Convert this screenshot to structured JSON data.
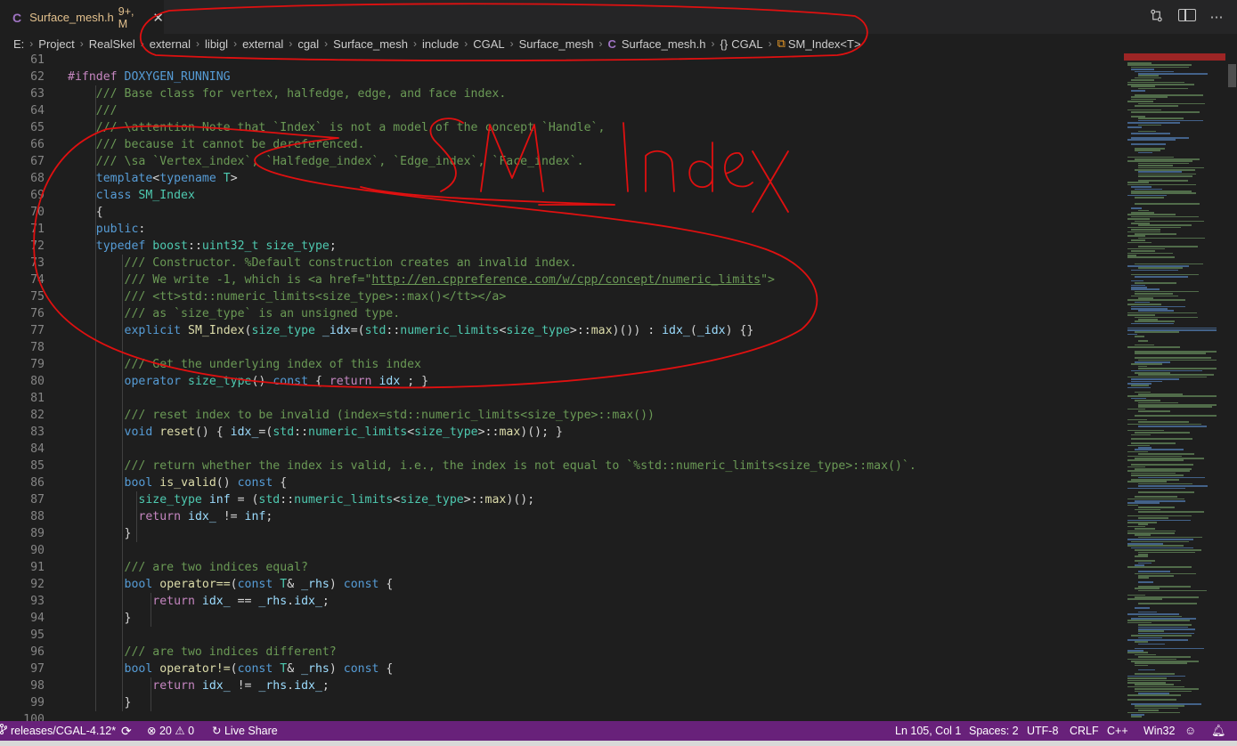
{
  "tab": {
    "icon_letter": "C",
    "filename": "Surface_mesh.h",
    "status": "9+, M",
    "close": "✕",
    "actions": {
      "compare_icon": "compare-changes-icon",
      "split_icon": "split-editor-icon",
      "more": "⋯"
    }
  },
  "breadcrumb": {
    "path": [
      "E:",
      "Project",
      "RealSkel",
      "external",
      "libigl",
      "external",
      "cgal",
      "Surface_mesh",
      "include",
      "CGAL",
      "Surface_mesh"
    ],
    "file_icon": "C",
    "file": "Surface_mesh.h",
    "namespace_icon": "{}",
    "namespace": "CGAL",
    "class_icon": "class-icon",
    "class": "SM_Index<T>"
  },
  "editor": {
    "lines": [
      {
        "n": "61",
        "t": ""
      },
      {
        "n": "62",
        "t": "#ifndef DOXYGEN_RUNNING"
      },
      {
        "n": "63",
        "t": "    /// Base class for vertex, halfedge, edge, and face index."
      },
      {
        "n": "64",
        "t": "    ///"
      },
      {
        "n": "65",
        "t": "    /// \\attention Note that `Index` is not a model of the concept `Handle`,"
      },
      {
        "n": "66",
        "t": "    /// because it cannot be dereferenced."
      },
      {
        "n": "67",
        "t": "    /// \\sa `Vertex_index`, `Halfedge_index`, `Edge_index`, `Face_index`."
      },
      {
        "n": "68",
        "t": "    template<typename T>"
      },
      {
        "n": "69",
        "t": "    class SM_Index"
      },
      {
        "n": "70",
        "t": "    {"
      },
      {
        "n": "71",
        "t": "    public:"
      },
      {
        "n": "72",
        "t": "    typedef boost::uint32_t size_type;"
      },
      {
        "n": "73",
        "t": "        /// Constructor. %Default construction creates an invalid index."
      },
      {
        "n": "74",
        "t": "        /// We write -1, which is <a href=\"http://en.cppreference.com/w/cpp/concept/numeric_limits\">"
      },
      {
        "n": "75",
        "t": "        /// <tt>std::numeric_limits<size_type>::max()</tt></a>"
      },
      {
        "n": "76",
        "t": "        /// as `size_type` is an unsigned type."
      },
      {
        "n": "77",
        "t": "        explicit SM_Index(size_type _idx=(std::numeric_limits<size_type>::max)()) : idx_(_idx) {}"
      },
      {
        "n": "78",
        "t": ""
      },
      {
        "n": "79",
        "t": "        /// Get the underlying index of this index"
      },
      {
        "n": "80",
        "t": "        operator size_type() const { return idx_; }"
      },
      {
        "n": "81",
        "t": ""
      },
      {
        "n": "82",
        "t": "        /// reset index to be invalid (index=std::numeric_limits<size_type>::max())"
      },
      {
        "n": "83",
        "t": "        void reset() { idx_=(std::numeric_limits<size_type>::max)(); }"
      },
      {
        "n": "84",
        "t": ""
      },
      {
        "n": "85",
        "t": "        /// return whether the index is valid, i.e., the index is not equal to `%std::numeric_limits<size_type>::max()`."
      },
      {
        "n": "86",
        "t": "        bool is_valid() const {"
      },
      {
        "n": "87",
        "t": "          size_type inf = (std::numeric_limits<size_type>::max)();"
      },
      {
        "n": "88",
        "t": "          return idx_ != inf;"
      },
      {
        "n": "89",
        "t": "        }"
      },
      {
        "n": "90",
        "t": ""
      },
      {
        "n": "91",
        "t": "        /// are two indices equal?"
      },
      {
        "n": "92",
        "t": "        bool operator==(const T& _rhs) const {"
      },
      {
        "n": "93",
        "t": "            return idx_ == _rhs.idx_;"
      },
      {
        "n": "94",
        "t": "        }"
      },
      {
        "n": "95",
        "t": ""
      },
      {
        "n": "96",
        "t": "        /// are two indices different?"
      },
      {
        "n": "97",
        "t": "        bool operator!=(const T& _rhs) const {"
      },
      {
        "n": "98",
        "t": "            return idx_ != _rhs.idx_;"
      },
      {
        "n": "99",
        "t": "        }"
      },
      {
        "n": "100",
        "t": ""
      }
    ]
  },
  "annotation": {
    "handwritten_text": "SM_Index",
    "color": "#e01010"
  },
  "statusbar": {
    "branch": "releases/CGAL-4.12*",
    "errors": "20",
    "warnings": "0",
    "live_share": "Live Share",
    "position": "Ln 105, Col 1",
    "spaces": "Spaces: 2",
    "encoding": "UTF-8",
    "eol": "CRLF",
    "language": "C++",
    "platform": "Win32",
    "background": "#68217a"
  }
}
